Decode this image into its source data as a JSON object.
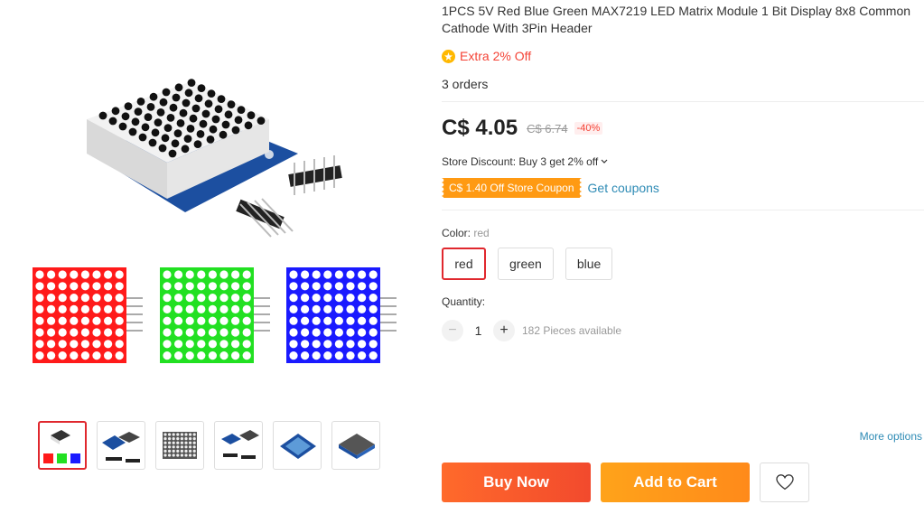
{
  "product": {
    "title": "1PCS 5V Red Blue Green MAX7219 LED Matrix Module 1 Bit Display 8x8 Common Cathode With 3Pin Header",
    "extra_discount": "Extra 2% Off",
    "orders": "3 orders"
  },
  "price": {
    "current": "C$ 4.05",
    "original": "C$ 6.74",
    "discount": "-40%"
  },
  "store_discount": {
    "text": "Store Discount: Buy 3 get 2% off",
    "chevron": "chevron-down-icon"
  },
  "coupon": {
    "label": "C$ 1.40 Off Store Coupon",
    "link": "Get coupons"
  },
  "color": {
    "label": "Color:",
    "selected": "red",
    "options": [
      "red",
      "green",
      "blue"
    ]
  },
  "quantity": {
    "label": "Quantity:",
    "minus": "−",
    "plus": "+",
    "value": "1",
    "available": "182 Pieces available"
  },
  "more_options": "More options",
  "actions": {
    "buy_now": "Buy Now",
    "add_to_cart": "Add to Cart",
    "wishlist_icon": "heart-icon"
  },
  "gallery": {
    "selected_index": 0,
    "thumbnail_count": 6
  },
  "colors": {
    "accent_red": "#e0282e",
    "price_red": "#f44336",
    "coupon_orange": "#ff9a13",
    "link_blue": "#2e8bb5",
    "led_red": "#ff1a1a",
    "led_green": "#22e022",
    "led_blue": "#1a1aff",
    "pcb_blue": "#1c4fa0"
  }
}
